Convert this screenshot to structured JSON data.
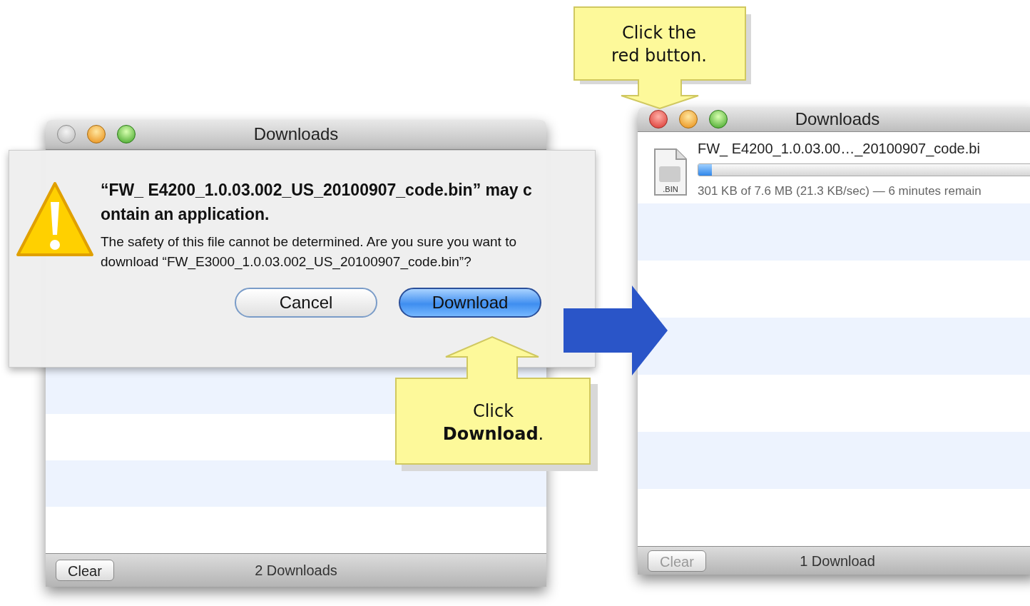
{
  "left_window": {
    "title": "Downloads",
    "close_enabled": false,
    "status": "2 Downloads",
    "clear_button": {
      "label": "Clear",
      "disabled": false
    }
  },
  "alert": {
    "title": "“FW_ E4200_1.0.03.002_US_20100907_code.bin” may contain an application.",
    "message": "The safety of this file cannot be determined. Are you sure you want to download “FW_E3000_1.0.03.002_US_20100907_code.bin”?",
    "buttons": [
      {
        "label": "Cancel",
        "default": false
      },
      {
        "label": "Download",
        "default": true
      }
    ]
  },
  "right_window": {
    "title": "Downloads",
    "close_enabled": true,
    "downloads": [
      {
        "name": "FW_ E4200_1.0.03.00…_20100907_code.bi",
        "icon_label": ".BIN",
        "level": 0.04,
        "status": "301 KB of 7.6 MB (21.3 KB/sec) — 6 minutes remain"
      }
    ],
    "status": "1 Download",
    "clear_button": {
      "label": "Clear",
      "disabled": true
    }
  },
  "callouts": [
    {
      "lines": [
        "Click the",
        "red button."
      ]
    },
    {
      "lines": [
        "Click",
        "**Download**."
      ]
    }
  ]
}
